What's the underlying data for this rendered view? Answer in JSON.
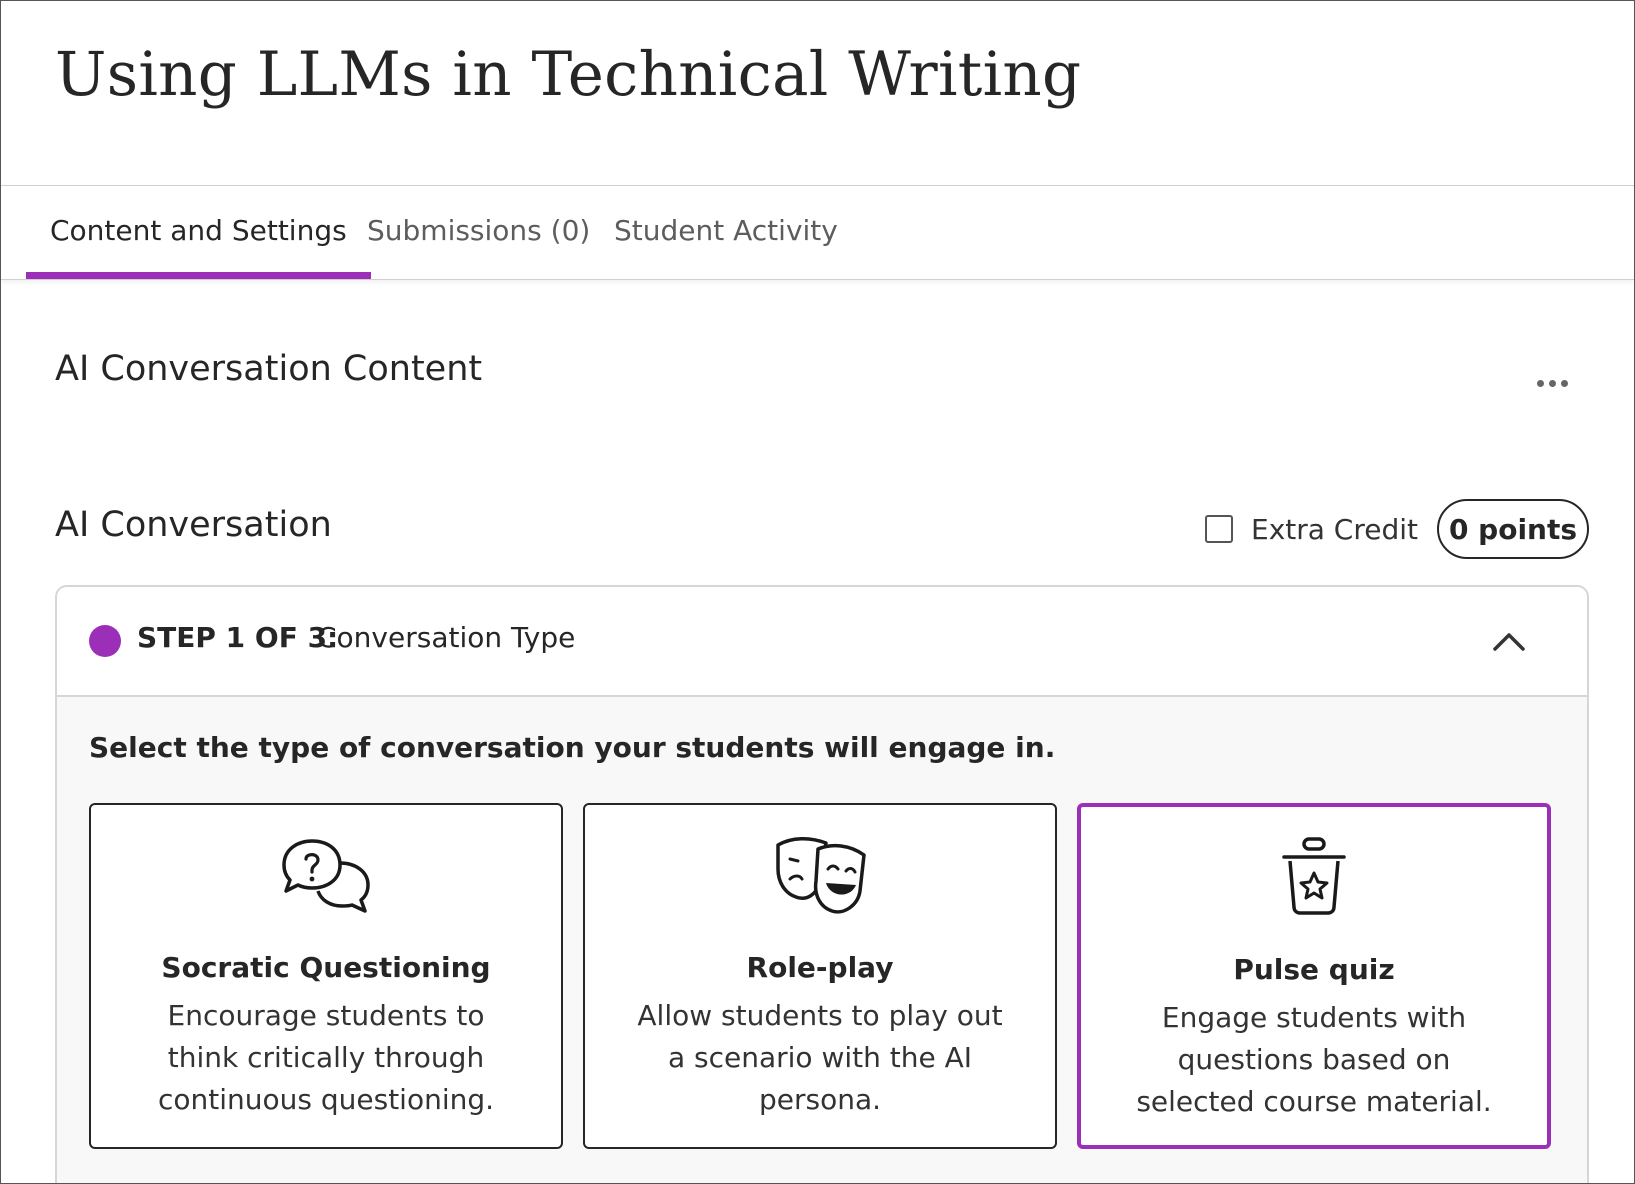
{
  "page": {
    "title": "Using LLMs in Technical Writing"
  },
  "tabs": [
    {
      "label": "Content and Settings",
      "active": true
    },
    {
      "label": "Submissions (0)",
      "active": false
    },
    {
      "label": "Student Activity",
      "active": false
    }
  ],
  "content_section": {
    "title": "AI Conversation Content",
    "more_icon": "ellipsis-icon"
  },
  "conversation": {
    "title": "AI Conversation",
    "extra_credit_label": "Extra Credit",
    "extra_credit_checked": false,
    "points_label": "0 points"
  },
  "step": {
    "label": "STEP 1 OF 3:",
    "name": "Conversation Type",
    "accent_color": "#9c2fb8",
    "toggle_icon": "chevron-up-icon",
    "instruction": "Select the type of conversation your students will engage in.",
    "options": [
      {
        "title": "Socratic Questioning",
        "description": "Encourage students to think critically through continuous questioning.",
        "icon": "question-bubbles-icon",
        "selected": false
      },
      {
        "title": "Role-play",
        "description": "Allow students to play out a scenario with the AI persona.",
        "icon": "theater-masks-icon",
        "selected": false
      },
      {
        "title": "Pulse quiz",
        "description": "Engage students with questions based on selected course material.",
        "icon": "quiz-bin-star-icon",
        "selected": true
      }
    ]
  }
}
